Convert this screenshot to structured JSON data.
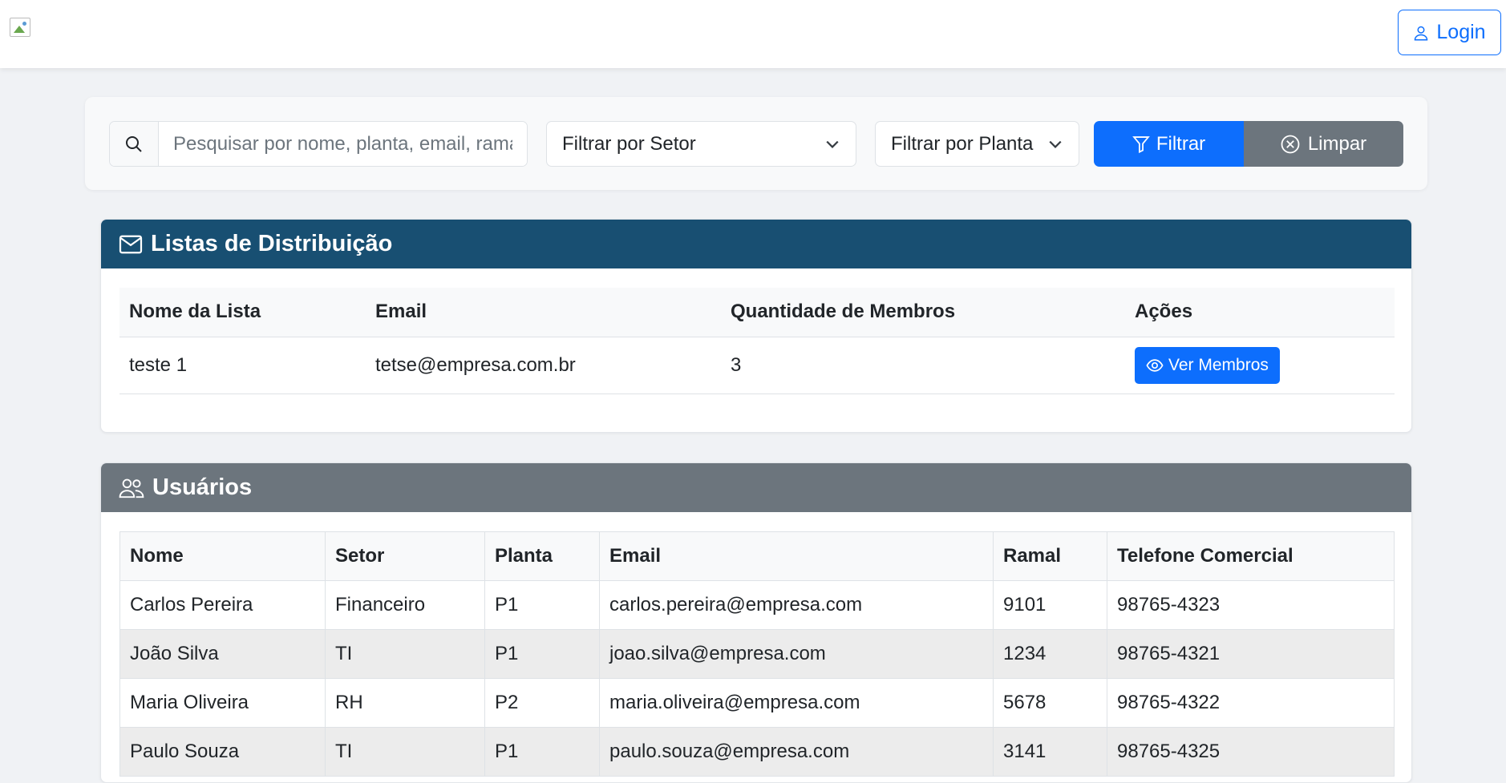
{
  "nav": {
    "login_label": "Login"
  },
  "filters": {
    "search_placeholder": "Pesquisar por nome, planta, email, ramal",
    "setor_select": "Filtrar por Setor",
    "planta_select": "Filtrar por Planta",
    "filter_button": "Filtrar",
    "clear_button": "Limpar"
  },
  "lists": {
    "title": "Listas de Distribuição",
    "columns": [
      "Nome da Lista",
      "Email",
      "Quantidade de Membros",
      "Ações"
    ],
    "rows": [
      {
        "name": "teste 1",
        "email": "tetse@empresa.com.br",
        "members": "3",
        "action": "Ver Membros"
      }
    ]
  },
  "users": {
    "title": "Usuários",
    "columns": [
      "Nome",
      "Setor",
      "Planta",
      "Email",
      "Ramal",
      "Telefone Comercial"
    ],
    "rows": [
      [
        "Carlos Pereira",
        "Financeiro",
        "P1",
        "carlos.pereira@empresa.com",
        "9101",
        "98765-4323"
      ],
      [
        "João Silva",
        "TI",
        "P1",
        "joao.silva@empresa.com",
        "1234",
        "98765-4321"
      ],
      [
        "Maria Oliveira",
        "RH",
        "P2",
        "maria.oliveira@empresa.com",
        "5678",
        "98765-4322"
      ],
      [
        "Paulo Souza",
        "TI",
        "P1",
        "paulo.souza@empresa.com",
        "3141",
        "98765-4325"
      ]
    ]
  },
  "colors": {
    "primary": "#0d6efd",
    "secondary": "#6c757d",
    "lists_header": "#184f72"
  }
}
